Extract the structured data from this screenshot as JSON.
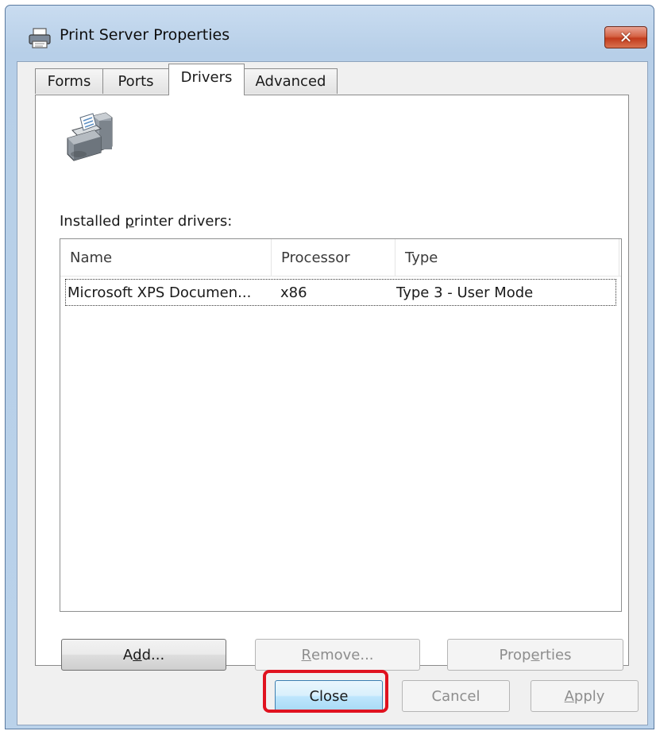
{
  "window": {
    "title": "Print Server Properties",
    "close_glyph": "✕"
  },
  "tabs": [
    {
      "label": "Forms"
    },
    {
      "label": "Ports"
    },
    {
      "label": "Drivers"
    },
    {
      "label": "Advanced"
    }
  ],
  "active_tab": "Drivers",
  "drivers_page": {
    "installed_label_pre": "Installed ",
    "installed_label_ul": "p",
    "installed_label_post": "rinter drivers:",
    "columns": [
      "Name",
      "Processor",
      "Type"
    ],
    "rows": [
      {
        "name": "Microsoft XPS Documen...",
        "processor": "x86",
        "type": "Type 3 - User Mode"
      }
    ],
    "buttons": {
      "add_pre": "A",
      "add_ul": "d",
      "add_post": "d...",
      "remove_ul": "R",
      "remove_post": "emove...",
      "properties_pre": "Prop",
      "properties_ul": "e",
      "properties_post": "rties"
    }
  },
  "footer": {
    "close_label": "Close",
    "cancel_label": "Cancel",
    "apply_ul": "A",
    "apply_post": "pply"
  },
  "colors": {
    "highlight": "#e0121f",
    "title_close_button": "#c23b1c"
  },
  "icons": [
    "printer-icon",
    "server-printer-icon",
    "close-icon"
  ]
}
